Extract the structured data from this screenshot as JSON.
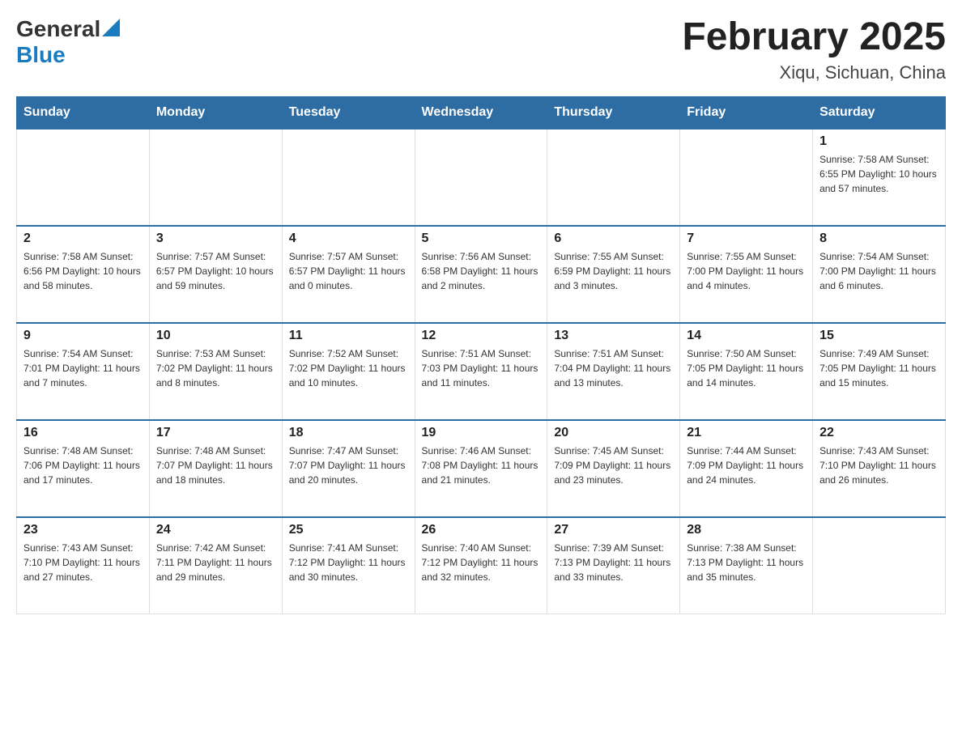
{
  "header": {
    "logo_general": "General",
    "logo_blue": "Blue",
    "month_title": "February 2025",
    "location": "Xiqu, Sichuan, China"
  },
  "days_of_week": [
    "Sunday",
    "Monday",
    "Tuesday",
    "Wednesday",
    "Thursday",
    "Friday",
    "Saturday"
  ],
  "weeks": [
    [
      {
        "day": "",
        "info": ""
      },
      {
        "day": "",
        "info": ""
      },
      {
        "day": "",
        "info": ""
      },
      {
        "day": "",
        "info": ""
      },
      {
        "day": "",
        "info": ""
      },
      {
        "day": "",
        "info": ""
      },
      {
        "day": "1",
        "info": "Sunrise: 7:58 AM\nSunset: 6:55 PM\nDaylight: 10 hours\nand 57 minutes."
      }
    ],
    [
      {
        "day": "2",
        "info": "Sunrise: 7:58 AM\nSunset: 6:56 PM\nDaylight: 10 hours\nand 58 minutes."
      },
      {
        "day": "3",
        "info": "Sunrise: 7:57 AM\nSunset: 6:57 PM\nDaylight: 10 hours\nand 59 minutes."
      },
      {
        "day": "4",
        "info": "Sunrise: 7:57 AM\nSunset: 6:57 PM\nDaylight: 11 hours\nand 0 minutes."
      },
      {
        "day": "5",
        "info": "Sunrise: 7:56 AM\nSunset: 6:58 PM\nDaylight: 11 hours\nand 2 minutes."
      },
      {
        "day": "6",
        "info": "Sunrise: 7:55 AM\nSunset: 6:59 PM\nDaylight: 11 hours\nand 3 minutes."
      },
      {
        "day": "7",
        "info": "Sunrise: 7:55 AM\nSunset: 7:00 PM\nDaylight: 11 hours\nand 4 minutes."
      },
      {
        "day": "8",
        "info": "Sunrise: 7:54 AM\nSunset: 7:00 PM\nDaylight: 11 hours\nand 6 minutes."
      }
    ],
    [
      {
        "day": "9",
        "info": "Sunrise: 7:54 AM\nSunset: 7:01 PM\nDaylight: 11 hours\nand 7 minutes."
      },
      {
        "day": "10",
        "info": "Sunrise: 7:53 AM\nSunset: 7:02 PM\nDaylight: 11 hours\nand 8 minutes."
      },
      {
        "day": "11",
        "info": "Sunrise: 7:52 AM\nSunset: 7:02 PM\nDaylight: 11 hours\nand 10 minutes."
      },
      {
        "day": "12",
        "info": "Sunrise: 7:51 AM\nSunset: 7:03 PM\nDaylight: 11 hours\nand 11 minutes."
      },
      {
        "day": "13",
        "info": "Sunrise: 7:51 AM\nSunset: 7:04 PM\nDaylight: 11 hours\nand 13 minutes."
      },
      {
        "day": "14",
        "info": "Sunrise: 7:50 AM\nSunset: 7:05 PM\nDaylight: 11 hours\nand 14 minutes."
      },
      {
        "day": "15",
        "info": "Sunrise: 7:49 AM\nSunset: 7:05 PM\nDaylight: 11 hours\nand 15 minutes."
      }
    ],
    [
      {
        "day": "16",
        "info": "Sunrise: 7:48 AM\nSunset: 7:06 PM\nDaylight: 11 hours\nand 17 minutes."
      },
      {
        "day": "17",
        "info": "Sunrise: 7:48 AM\nSunset: 7:07 PM\nDaylight: 11 hours\nand 18 minutes."
      },
      {
        "day": "18",
        "info": "Sunrise: 7:47 AM\nSunset: 7:07 PM\nDaylight: 11 hours\nand 20 minutes."
      },
      {
        "day": "19",
        "info": "Sunrise: 7:46 AM\nSunset: 7:08 PM\nDaylight: 11 hours\nand 21 minutes."
      },
      {
        "day": "20",
        "info": "Sunrise: 7:45 AM\nSunset: 7:09 PM\nDaylight: 11 hours\nand 23 minutes."
      },
      {
        "day": "21",
        "info": "Sunrise: 7:44 AM\nSunset: 7:09 PM\nDaylight: 11 hours\nand 24 minutes."
      },
      {
        "day": "22",
        "info": "Sunrise: 7:43 AM\nSunset: 7:10 PM\nDaylight: 11 hours\nand 26 minutes."
      }
    ],
    [
      {
        "day": "23",
        "info": "Sunrise: 7:43 AM\nSunset: 7:10 PM\nDaylight: 11 hours\nand 27 minutes."
      },
      {
        "day": "24",
        "info": "Sunrise: 7:42 AM\nSunset: 7:11 PM\nDaylight: 11 hours\nand 29 minutes."
      },
      {
        "day": "25",
        "info": "Sunrise: 7:41 AM\nSunset: 7:12 PM\nDaylight: 11 hours\nand 30 minutes."
      },
      {
        "day": "26",
        "info": "Sunrise: 7:40 AM\nSunset: 7:12 PM\nDaylight: 11 hours\nand 32 minutes."
      },
      {
        "day": "27",
        "info": "Sunrise: 7:39 AM\nSunset: 7:13 PM\nDaylight: 11 hours\nand 33 minutes."
      },
      {
        "day": "28",
        "info": "Sunrise: 7:38 AM\nSunset: 7:13 PM\nDaylight: 11 hours\nand 35 minutes."
      },
      {
        "day": "",
        "info": ""
      }
    ]
  ]
}
